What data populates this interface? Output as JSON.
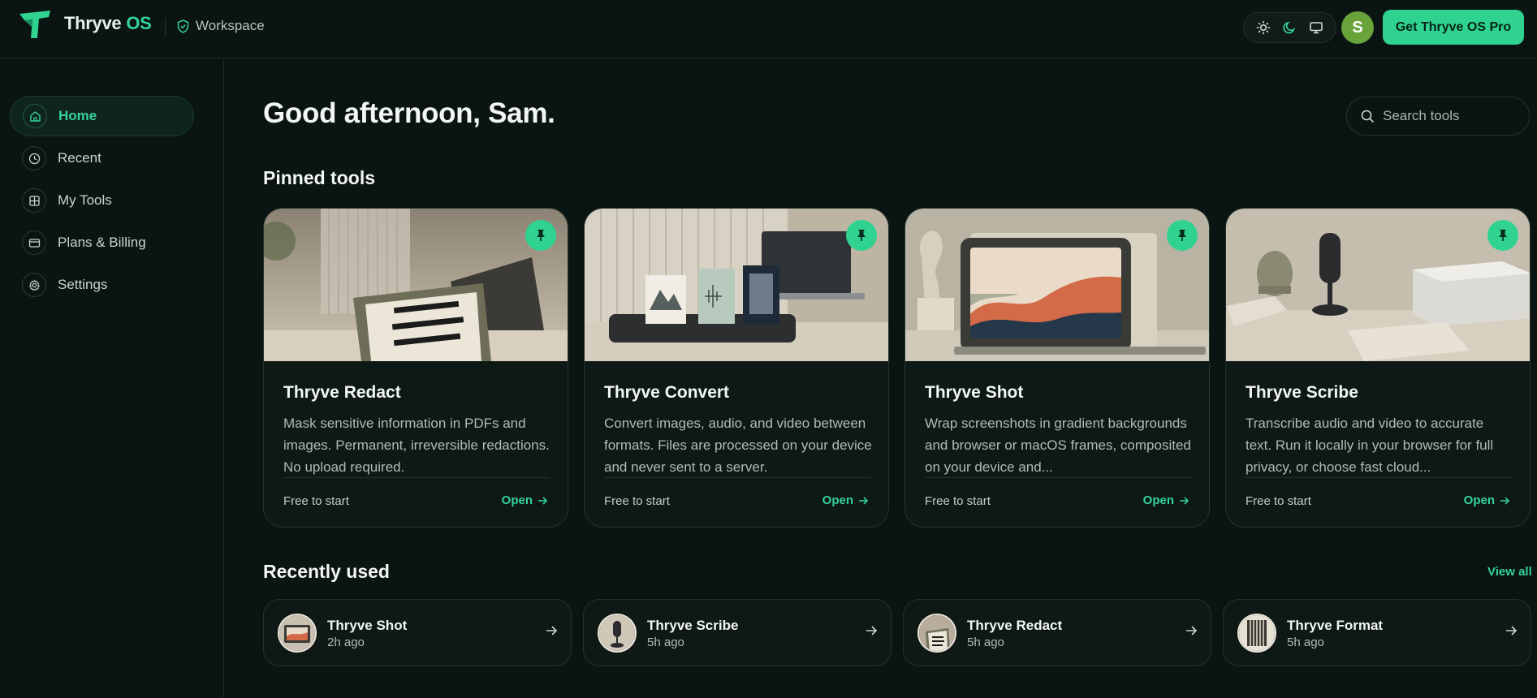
{
  "header": {
    "brand_name": "Thryve",
    "brand_suffix": "OS",
    "workspace_label": "Workspace",
    "theme_options": [
      "sun-icon",
      "moon-icon",
      "monitor-icon"
    ],
    "avatar_initial": "S",
    "pro_button": "Get Thryve OS Pro"
  },
  "sidebar": {
    "items": [
      {
        "label": "Home",
        "icon": "home-icon",
        "active": true
      },
      {
        "label": "Recent",
        "icon": "clock-icon"
      },
      {
        "label": "My Tools",
        "icon": "grid-icon"
      },
      {
        "label": "Plans & Billing",
        "icon": "credit-card-icon"
      },
      {
        "label": "Settings",
        "icon": "gear-icon"
      }
    ]
  },
  "main": {
    "greeting": "Good afternoon, Sam.",
    "search_placeholder": "Search tools",
    "pinned_title": "Pinned tools",
    "pinned": [
      {
        "title": "Thryve Redact",
        "desc": "Mask sensitive information in PDFs and images. Permanent, irreversible redactions. No upload required.",
        "price": "Free to start",
        "action": "Open"
      },
      {
        "title": "Thryve Convert",
        "desc": "Convert images, audio, and video between formats. Files are processed on your device and never sent to a server.",
        "price": "Free to start",
        "action": "Open"
      },
      {
        "title": "Thryve Shot",
        "desc": "Wrap screenshots in gradient backgrounds and browser or macOS frames, composited on your device and...",
        "price": "Free to start",
        "action": "Open"
      },
      {
        "title": "Thryve Scribe",
        "desc": "Transcribe audio and video to accurate text. Run it locally in your browser for full privacy, or choose fast cloud...",
        "price": "Free to start",
        "action": "Open"
      }
    ],
    "recent_title": "Recently used",
    "view_all": "View all",
    "recent": [
      {
        "title": "Thryve Shot",
        "time": "2h ago"
      },
      {
        "title": "Thryve Scribe",
        "time": "5h ago"
      },
      {
        "title": "Thryve Redact",
        "time": "5h ago"
      },
      {
        "title": "Thryve Format",
        "time": "5h ago"
      }
    ]
  },
  "colors": {
    "background": "#0a1412",
    "accent": "#2fd38f",
    "accent_text": "#34d399",
    "card_bg": "#0e1916",
    "avatar": "#6aa33a"
  }
}
